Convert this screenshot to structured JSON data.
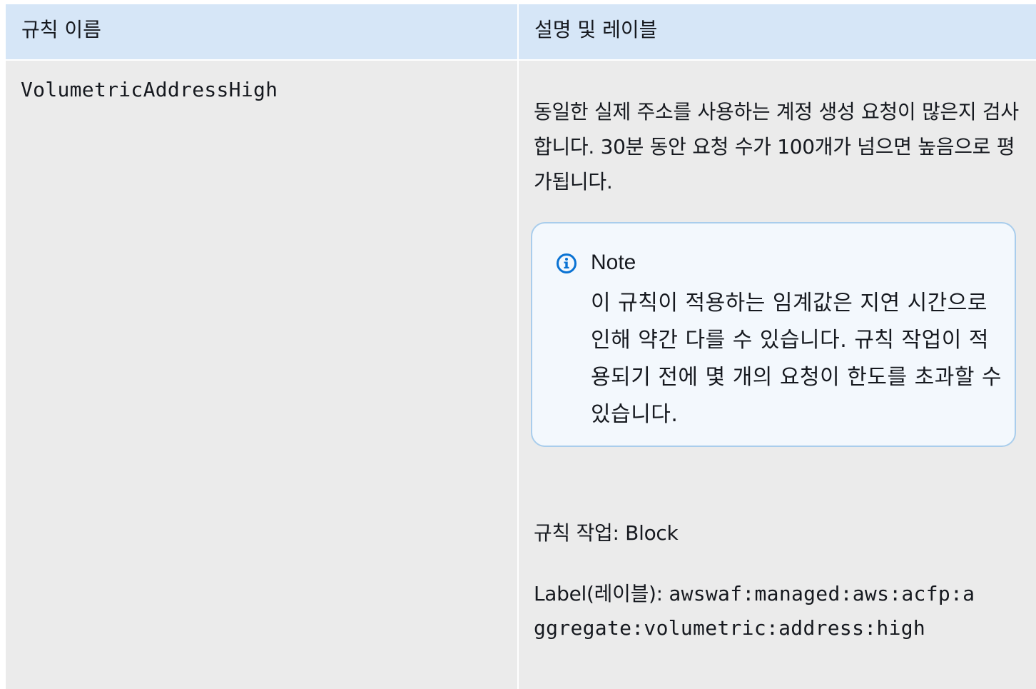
{
  "table": {
    "headers": {
      "rule_name": "규칙 이름",
      "description_and_label": "설명 및 레이블"
    },
    "row": {
      "rule_name": "VolumetricAddressHigh",
      "description": "동일한 실제 주소를 사용하는 계정 생성 요청이 많은지 검사합니다. 30분 동안 요청 수가 100개가 넘으면 높음으로 평가됩니다.",
      "note": {
        "icon": "info-icon",
        "title": "Note",
        "text": "이 규칙이 적용하는 임계값은 지연 시간으로 인해 약간 다를 수 있습니다. 규칙 작업이 적용되기 전에 몇 개의 요청이 한도를 초과할 수 있습니다."
      },
      "rule_action": "규칙 작업: Block",
      "label_prefix": "Label(레이블): ",
      "label_value": "awswaf:managed:aws:acfp:aggregate:volumetric:address:high"
    }
  },
  "colors": {
    "header_bg": "#d6e6f7",
    "cell_bg": "#ebebeb",
    "note_border": "#a9cdec",
    "note_bg": "#f3f8fd",
    "info_icon": "#0972d3"
  }
}
